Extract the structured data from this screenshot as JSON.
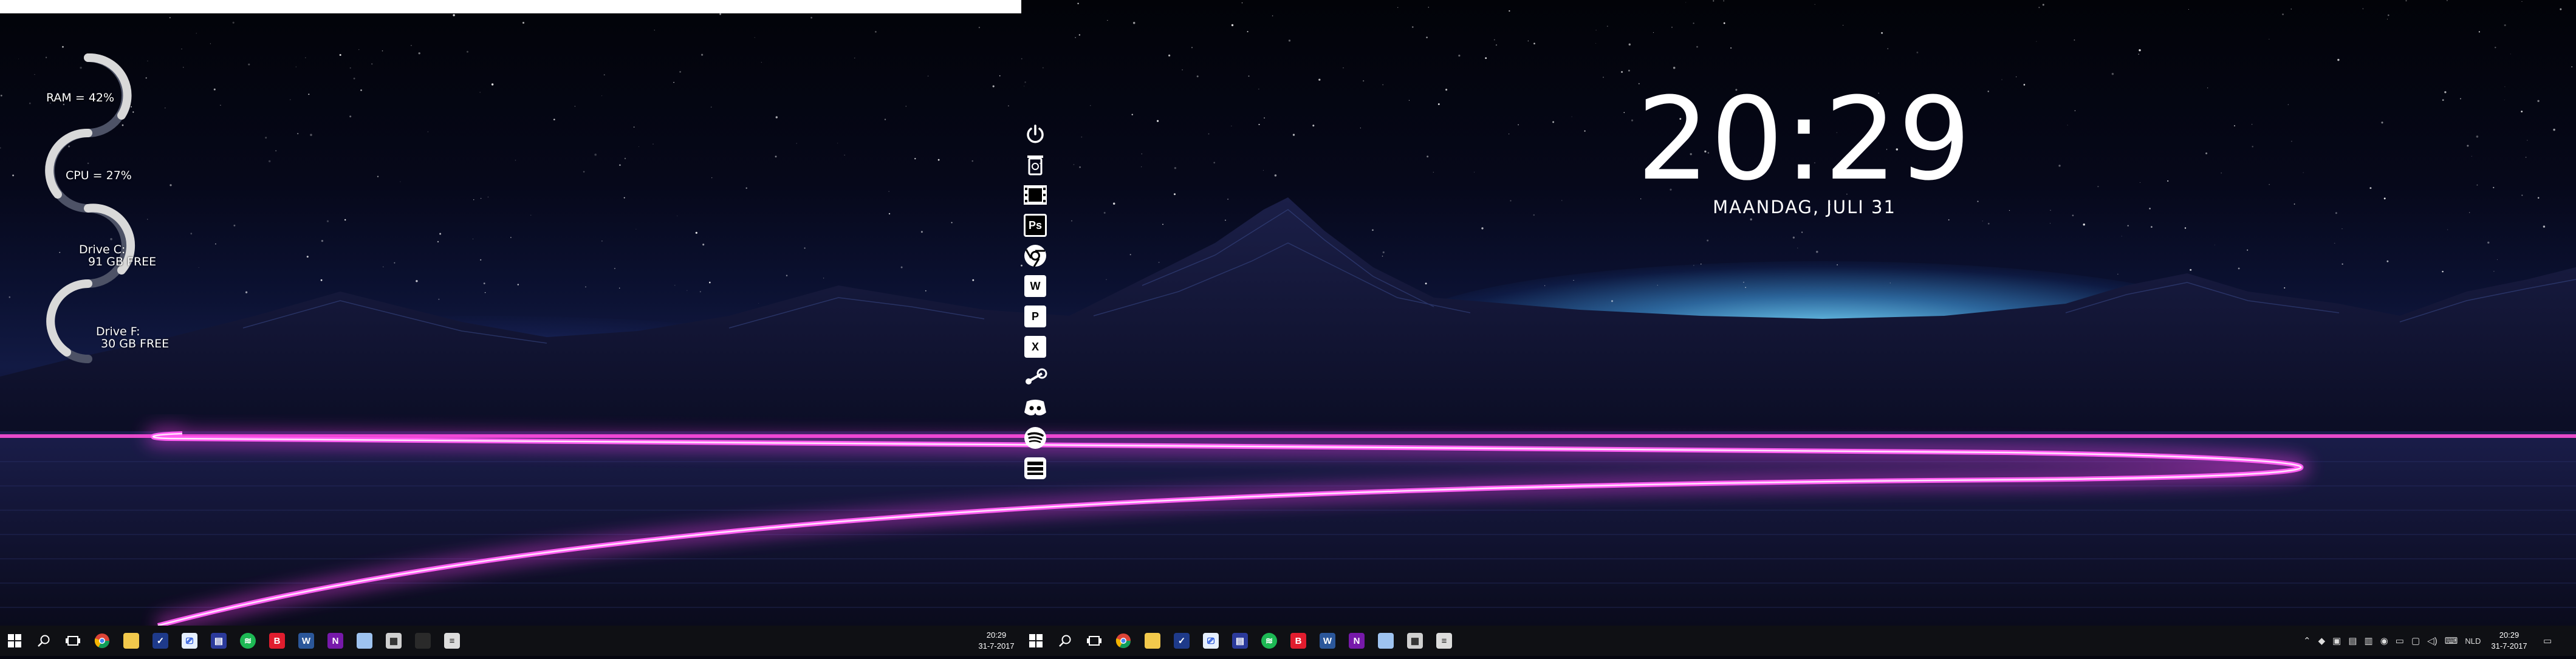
{
  "desktop": {
    "clock_time": "20:29",
    "clock_date": "MAANDAG, JULI 31",
    "accent_colors": {
      "neon_pink": "#ff3df2",
      "sky_glow": "#7ee0ff",
      "taskbar": "#0f1014"
    }
  },
  "system_widgets": {
    "ram": "RAM = 42%",
    "cpu": "CPU = 27%",
    "drive_c_label": "Drive C:",
    "drive_c_free": "91 GB FREE",
    "drive_f_label": "Drive F:",
    "drive_f_free": "30 GB FREE"
  },
  "launcher": {
    "items": [
      {
        "icon": "power-icon"
      },
      {
        "icon": "recycle-bin-icon"
      },
      {
        "icon": "film-icon"
      },
      {
        "icon": "photoshop-icon",
        "text": "Ps"
      },
      {
        "icon": "chrome-icon"
      },
      {
        "icon": "word-icon",
        "text": "W"
      },
      {
        "icon": "powerpoint-icon",
        "text": "P"
      },
      {
        "icon": "excel-icon",
        "text": "X"
      },
      {
        "icon": "steam-icon"
      },
      {
        "icon": "discord-icon"
      },
      {
        "icon": "spotify-icon"
      },
      {
        "icon": "cooler-master-icon"
      }
    ]
  },
  "taskbar_left": {
    "icons": [
      "windows-start-icon",
      "search-icon",
      "task-view-icon",
      "chrome-icon",
      "file-explorer-icon",
      "todo-icon",
      "remote-desktop-icon",
      "app-icon",
      "spotify-icon",
      "b-app-icon",
      "word-icon",
      "onenote-icon",
      "app-icon-2",
      "calculator-icon",
      "app-icon-3",
      "app-icon-4"
    ],
    "clock_time": "20:29",
    "clock_date": "31-7-2017"
  },
  "taskbar_right": {
    "icons": [
      "windows-start-icon",
      "search-icon",
      "task-view-icon",
      "chrome-icon",
      "file-explorer-icon",
      "todo-icon",
      "remote-desktop-icon",
      "app-icon",
      "spotify-icon",
      "b-app-icon",
      "word-icon",
      "onenote-icon",
      "app-icon-2",
      "calculator-icon",
      "app-icon-3"
    ],
    "language": "NLD",
    "clock_time": "20:29",
    "clock_date": "31-7-2017"
  }
}
